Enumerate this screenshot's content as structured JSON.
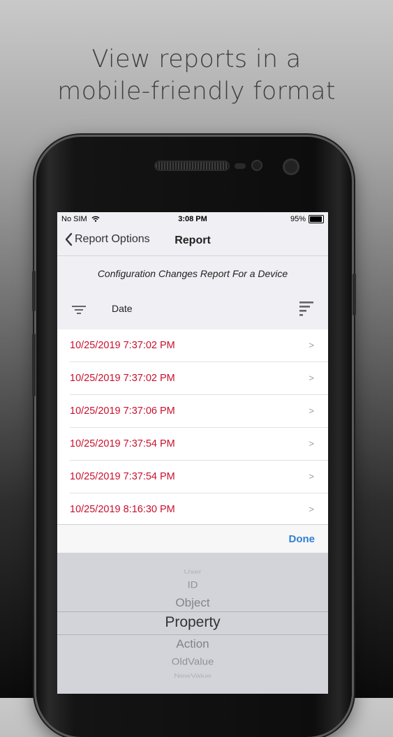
{
  "headline": {
    "line1": "View reports in a",
    "line2": "mobile-friendly format"
  },
  "status_bar": {
    "carrier": "No SIM",
    "time": "3:08 PM",
    "battery": "95%",
    "battery_level": 0.95
  },
  "nav": {
    "back_label": "Report Options",
    "title": "Report"
  },
  "report": {
    "title": "Configuration Changes Report For a Device",
    "sort_field": "Date"
  },
  "rows": [
    {
      "date": "10/25/2019 7:37:02 PM",
      "chevron": ">"
    },
    {
      "date": "10/25/2019 7:37:02 PM",
      "chevron": ">"
    },
    {
      "date": "10/25/2019 7:37:06 PM",
      "chevron": ">"
    },
    {
      "date": "10/25/2019 7:37:54 PM",
      "chevron": ">"
    },
    {
      "date": "10/25/2019 7:37:54 PM",
      "chevron": ">"
    },
    {
      "date": "10/25/2019 8:16:30 PM",
      "chevron": ">"
    }
  ],
  "toolbar": {
    "done_label": "Done"
  },
  "picker": {
    "options": [
      "User",
      "ID",
      "Object",
      "Property",
      "Action",
      "OldValue",
      "NewValue"
    ],
    "selected": "Property"
  },
  "colors": {
    "date_text": "#c8102e",
    "done_text": "#2f80d4"
  },
  "icons": {
    "back": "chevron-left-icon",
    "wifi": "wifi-icon",
    "battery": "battery-icon",
    "filter": "filter-icon",
    "sort": "sort-icon"
  }
}
